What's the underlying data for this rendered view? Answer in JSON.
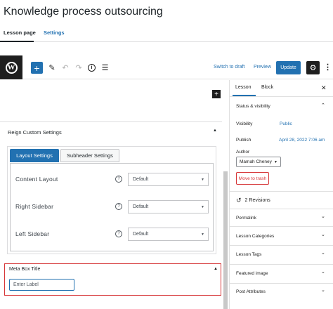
{
  "page": {
    "title": "Knowledge process outsourcing",
    "tabs": [
      "Lesson page",
      "Settings"
    ]
  },
  "toolbar": {
    "add_icon": "+",
    "pen_icon": "✎",
    "undo_icon": "↶",
    "redo_icon": "↷",
    "info_icon": "i",
    "list_icon": "☰",
    "switch_draft": "Switch to draft",
    "preview": "Preview",
    "update": "Update",
    "gear_icon": "⚙",
    "more_icon": "⋮",
    "wp_logo": "W"
  },
  "editor": {
    "inserter_icon": "+",
    "reign": {
      "title": "Reign Custom Settings",
      "toggle_icon": "▲",
      "tabs": [
        "Layout Settings",
        "Subheader Settings"
      ],
      "rows": [
        {
          "label": "Content Layout",
          "value": "Default"
        },
        {
          "label": "Right Sidebar",
          "value": "Default"
        },
        {
          "label": "Left Sidebar",
          "value": "Default"
        }
      ],
      "help_icon": "?",
      "caret_icon": "▼"
    },
    "metabox": {
      "title": "Meta Box Title",
      "toggle_icon": "▲",
      "input_value": "Enter Label"
    }
  },
  "sidebar": {
    "tabs": [
      "Lesson",
      "Block"
    ],
    "close_icon": "✕",
    "status": {
      "title": "Status & visibility",
      "chevron_up": "⌃",
      "visibility_label": "Visibility",
      "visibility_value": "Public",
      "publish_label": "Publish",
      "publish_value": "April 28, 2022 7:06 am",
      "author_label": "Author",
      "author_value": "Mamah Cheney",
      "trash": "Move to trash"
    },
    "revisions": {
      "icon": "↺",
      "label": "2 Revisions"
    },
    "panels": [
      "Permalink",
      "Lesson Categories",
      "Lesson Tags",
      "Featured image",
      "Post Attributes"
    ],
    "chevron_down": "⌄"
  },
  "colors": {
    "accent": "#2271b1",
    "danger": "#d63638",
    "dark": "#1e1e1e"
  }
}
